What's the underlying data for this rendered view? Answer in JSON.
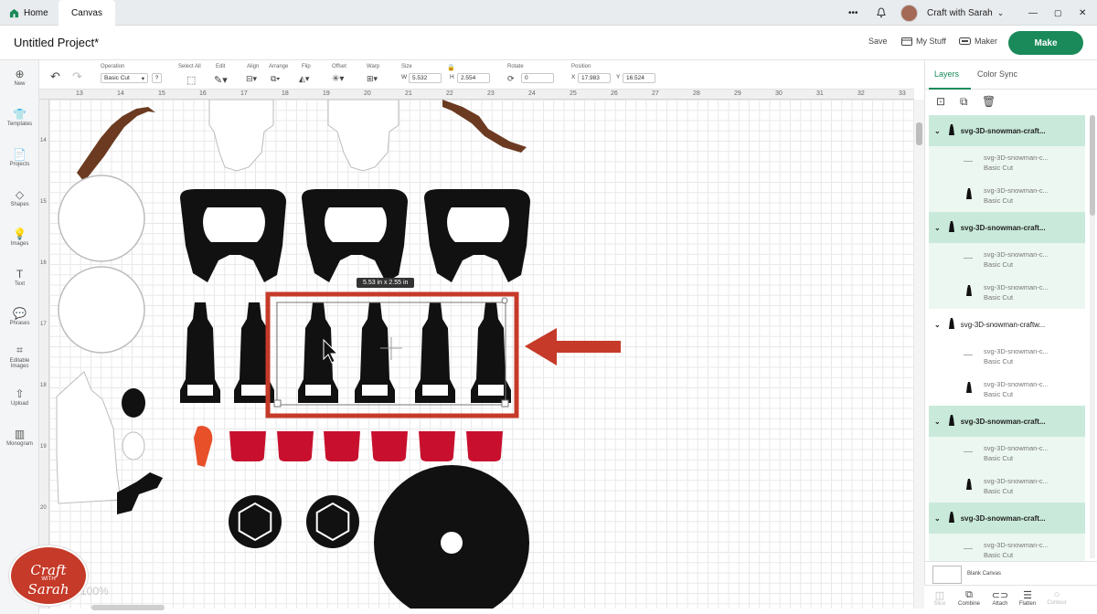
{
  "tabs": {
    "home": "Home",
    "canvas": "Canvas"
  },
  "window": {
    "more": "•••",
    "user": "Craft with Sarah",
    "minimize": "—",
    "maximize": "▢",
    "close": "✕"
  },
  "header": {
    "title": "Untitled Project*",
    "save": "Save",
    "mystuff": "My Stuff",
    "maker": "Maker",
    "make": "Make"
  },
  "left_nav": [
    {
      "label": "New",
      "icon": "⊕"
    },
    {
      "label": "Templates",
      "icon": "👕"
    },
    {
      "label": "Projects",
      "icon": "📄"
    },
    {
      "label": "Shapes",
      "icon": "◇"
    },
    {
      "label": "Images",
      "icon": "💡"
    },
    {
      "label": "Text",
      "icon": "T"
    },
    {
      "label": "Phrases",
      "icon": "💬"
    },
    {
      "label": "Editable Images",
      "icon": "⌗"
    },
    {
      "label": "Upload",
      "icon": "⇧"
    },
    {
      "label": "Monogram",
      "icon": "▥"
    }
  ],
  "toolbar": {
    "operation_label": "Operation",
    "operation_value": "Basic Cut",
    "select_all": "Select All",
    "edit": "Edit",
    "align": "Align",
    "arrange": "Arrange",
    "flip": "Flip",
    "offset": "Offset",
    "warp": "Warp",
    "size": "Size",
    "w_label": "W",
    "w_value": "5.532",
    "h_label": "H",
    "h_value": "2.554",
    "rotate": "Rotate",
    "rotate_value": "0",
    "position": "Position",
    "x_label": "X",
    "x_value": "17.983",
    "y_label": "Y",
    "y_value": "16.524"
  },
  "ruler_top": [
    "13",
    "14",
    "15",
    "16",
    "17",
    "18",
    "19",
    "20",
    "21",
    "22",
    "23",
    "24",
    "25",
    "26",
    "27",
    "28",
    "29",
    "30",
    "31",
    "32",
    "33"
  ],
  "ruler_left": [
    "14",
    "15",
    "16",
    "17",
    "18",
    "19",
    "20",
    "21"
  ],
  "canvas": {
    "dims_tooltip": "5.53  in x 2.55  in",
    "zoom": "100%"
  },
  "panel": {
    "tab_layers": "Layers",
    "tab_colorsync": "Color Sync",
    "groups": [
      {
        "name": "svg-3D-snowman-craft...",
        "selected": true,
        "subs": [
          {
            "name": "svg-3D-snowman-c...",
            "op": "Basic Cut"
          },
          {
            "name": "svg-3D-snowman-c...",
            "op": "Basic Cut"
          }
        ]
      },
      {
        "name": "svg-3D-snowman-craft...",
        "selected": true,
        "subs": [
          {
            "name": "svg-3D-snowman-c...",
            "op": "Basic Cut"
          },
          {
            "name": "svg-3D-snowman-c...",
            "op": "Basic Cut"
          }
        ]
      },
      {
        "name": "svg-3D-snowman-craftw...",
        "selected": false,
        "subs": [
          {
            "name": "svg-3D-snowman-c...",
            "op": "Basic Cut"
          },
          {
            "name": "svg-3D-snowman-c...",
            "op": "Basic Cut"
          }
        ]
      },
      {
        "name": "svg-3D-snowman-craft...",
        "selected": true,
        "subs": [
          {
            "name": "svg-3D-snowman-c...",
            "op": "Basic Cut"
          },
          {
            "name": "svg-3D-snowman-c...",
            "op": "Basic Cut"
          }
        ]
      },
      {
        "name": "svg-3D-snowman-craft...",
        "selected": true,
        "subs": [
          {
            "name": "svg-3D-snowman-c...",
            "op": "Basic Cut"
          }
        ]
      }
    ],
    "blank_canvas": "Blank Canvas",
    "bottom_tools": [
      {
        "label": "Slice",
        "icon": "◫",
        "enabled": false
      },
      {
        "label": "Combine",
        "icon": "⧉",
        "enabled": true
      },
      {
        "label": "Attach",
        "icon": "⊂⊃",
        "enabled": true
      },
      {
        "label": "Flatten",
        "icon": "☰",
        "enabled": true
      },
      {
        "label": "Contour",
        "icon": "○",
        "enabled": false
      }
    ]
  },
  "watermark": {
    "line1": "Craft",
    "line2": "WITH",
    "line3": "Sarah"
  },
  "colors": {
    "accent": "#1a8a5a",
    "highlight": "#c53a28",
    "selection": "#c9eadb"
  }
}
